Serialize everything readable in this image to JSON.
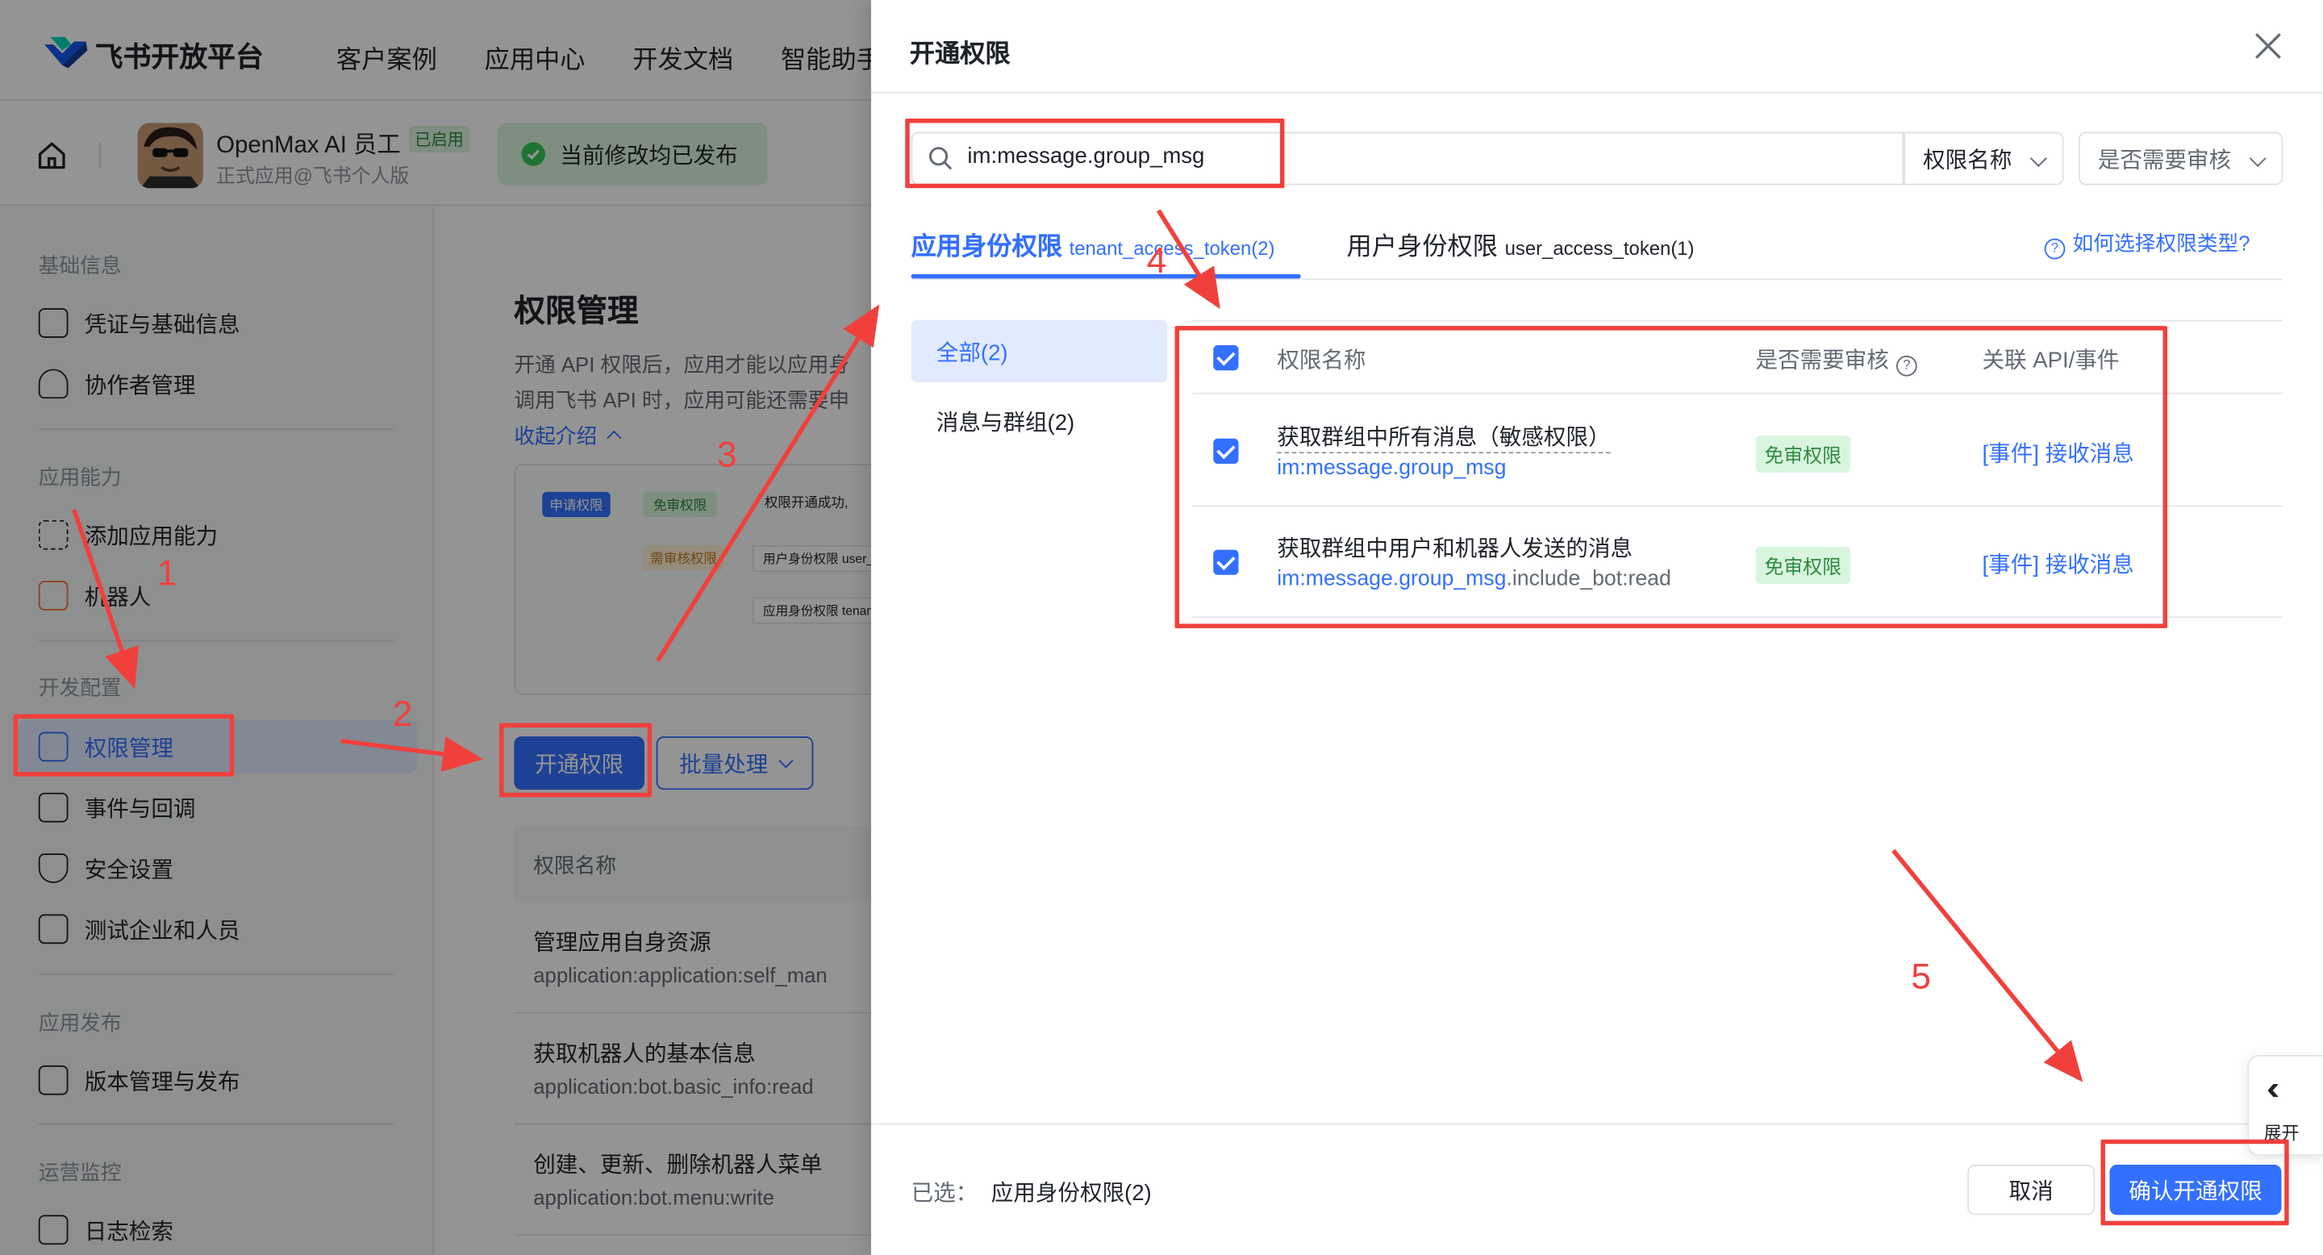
{
  "topnav": {
    "logo_text": "飞书开放平台",
    "items": [
      "客户案例",
      "应用中心",
      "开发文档",
      "智能助手"
    ]
  },
  "appbar": {
    "app_name": "OpenMax AI 员工",
    "badge": "已启用",
    "sub": "正式应用@飞书个人版",
    "published": "当前修改均已发布"
  },
  "sidebar": {
    "sections": [
      {
        "title": "基础信息",
        "items": [
          "凭证与基础信息",
          "协作者管理"
        ]
      },
      {
        "title": "应用能力",
        "items": [
          "添加应用能力",
          "机器人"
        ]
      },
      {
        "title": "开发配置",
        "items": [
          "权限管理",
          "事件与回调",
          "安全设置",
          "测试企业和人员"
        ]
      },
      {
        "title": "应用发布",
        "items": [
          "版本管理与发布"
        ]
      },
      {
        "title": "运营监控",
        "items": [
          "日志检索"
        ]
      }
    ],
    "active": "权限管理"
  },
  "content": {
    "title": "权限管理",
    "desc_line1": "开通 API 权限后，应用才能以应用身",
    "desc_line2": "调用飞书 API 时，应用可能还需要申",
    "collapse": "收起介绍",
    "flow": {
      "apply": "申请权限",
      "free": "免审权限",
      "success": "权限开通成功,",
      "need_review": "需审核权限",
      "user_id": "用户身份权限 user_",
      "app_id": "应用身份权限 tenant"
    },
    "open_button": "开通权限",
    "batch_button": "批量处理",
    "table_header": "权限名称",
    "rows": [
      {
        "name": "管理应用自身资源",
        "code": "application:application:self_man"
      },
      {
        "name": "获取机器人的基本信息",
        "code": "application:bot.basic_info:read"
      },
      {
        "name": "创建、更新、删除机器人菜单",
        "code": "application:bot.menu:write"
      }
    ]
  },
  "drawer": {
    "title": "开通权限",
    "search": {
      "value": "im:message.group_msg"
    },
    "select_name": "权限名称",
    "select_review": "是否需要审核",
    "tabs": [
      {
        "label": "应用身份权限",
        "sub": "tenant_access_token(2)"
      },
      {
        "label": "用户身份权限",
        "sub": "user_access_token(1)"
      }
    ],
    "help": "如何选择权限类型?",
    "categories": [
      "全部(2)",
      "消息与群组(2)"
    ],
    "headers": {
      "name": "权限名称",
      "review": "是否需要审核",
      "api": "关联 API/事件"
    },
    "rows": [
      {
        "name": "获取群组中所有消息（敏感权限）",
        "code_hl": "im:message.group_msg",
        "code_rest": "",
        "review": "免审权限",
        "api": "[事件] 接收消息"
      },
      {
        "name": "获取群组中用户和机器人发送的消息",
        "code_hl": "im:message.group_msg",
        "code_rest": ".include_bot:read",
        "review": "免审权限",
        "api": "[事件] 接收消息"
      }
    ],
    "footer": {
      "selected_label": "已选：",
      "selected_value": "应用身份权限(2)",
      "cancel": "取消",
      "confirm": "确认开通权限"
    },
    "expand": "展开"
  },
  "annotations": [
    "1",
    "2",
    "3",
    "4",
    "5"
  ],
  "colors": {
    "accent": "#3370ff",
    "annotation": "#f1403c",
    "success": "#34c759"
  }
}
